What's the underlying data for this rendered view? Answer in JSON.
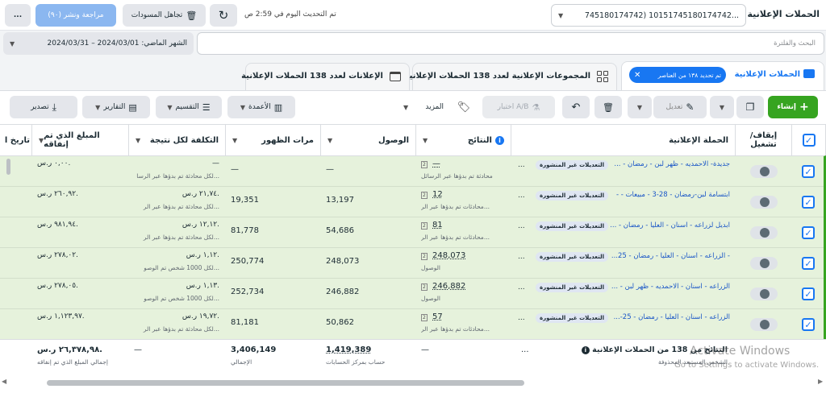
{
  "topbar": {
    "title": "الحملات الإعلانية",
    "account_selector": "745180174742)  10151745180174742...",
    "updated_text": "تم التحديث اليوم في 2:59 ص",
    "discard_label": "تجاهل المسودات",
    "review_label": "مراجعة ونشر (٩٠)",
    "more": "..."
  },
  "filters": {
    "search_placeholder": "البحث والفلترة",
    "date_range": "الشهر الماضي: 2024/03/01 – 2024/03/31"
  },
  "tabs": {
    "campaigns": "الحملات الإعلانية",
    "selected_chip": "تم تحديد ١٣٨ من العناصر",
    "adsets": "المجموعات الإعلانية لعدد 138 الحملات الإعلانية",
    "ads": "الإعلانات لعدد 138 الحملات الإعلانية"
  },
  "toolbar": {
    "create": "إنشاء",
    "edit": "تعديل",
    "ab_test": "اختبار A/B",
    "more": "المزيد",
    "columns": "الأعمدة",
    "breakdown": "التقسيم",
    "reports": "التقارير",
    "export": "تصدير"
  },
  "columns": {
    "toggle": "إيقاف/ تشغيل",
    "campaign": "الحملة الإعلانية",
    "results": "النتائج",
    "reach": "الوصول",
    "impressions": "مرات الظهور",
    "cost": "التكلفة لكل نتيجة",
    "spent": "المبلغ الذي تم إنفاقه",
    "end": "تاريخ ا"
  },
  "draft_badge": "التعديلات غير المنشورة",
  "rows": [
    {
      "campaign": "جديدة- الاحمديه - ظهر لبن - رمضان - ...",
      "results": "—",
      "results_sub": "محادثة تم بدؤها عبر الرسائل",
      "reach": "—",
      "impressions": "—",
      "cost": "—",
      "cost_sub": "لكل محادثة تم بدؤها عبر الرسا...",
      "spent": "٠,٠٠ ر.س."
    },
    {
      "campaign": "ابتسامة لبن-رمضان - 28-3 - مبيعات - -",
      "results": "12",
      "results_sub": "محادثات تم بدؤها عبر الر...",
      "reach": "13,197",
      "impressions": "19,351",
      "cost": "٢١,٧٤ ر.س.",
      "cost_sub": "لكل محادثة تم بدؤها عبر الر...",
      "spent": "٢٦٠,٩٢ ر.س."
    },
    {
      "campaign": "ابديل لزراعه - اسنان - العليا - رمضان - ...",
      "results": "81",
      "results_sub": "محادثات تم بدؤها عبر الر...",
      "reach": "54,686",
      "impressions": "81,778",
      "cost": "١٢,١٢ ر.س.",
      "cost_sub": "لكل محادثة تم بدؤها عبر الر...",
      "spent": "٩٨١,٩٤ ر.س."
    },
    {
      "campaign": "- الزراعه - اسنان - العليا - رمضان - 25...",
      "results": "248,073",
      "results_sub": "الوصول",
      "reach": "248,073",
      "impressions": "250,774",
      "cost": "١,١٢ ر.س.",
      "cost_sub": "لكل 1000 شخص تم الوصو...",
      "spent": "٢٧٨,٠٢ ر.س."
    },
    {
      "campaign": "الزراعه - اسنان - الاحمديه - ظهر لبن - ...",
      "results": "246,882",
      "results_sub": "الوصول",
      "reach": "246,882",
      "impressions": "252,734",
      "cost": "١,١٣ ر.س.",
      "cost_sub": "لكل 1000 شخص تم الوصو...",
      "spent": "٢٧٨,٠٥ ر.س."
    },
    {
      "campaign": "الزراعه - اسنان - العليا - رمضان - 25-...",
      "results": "57",
      "results_sub": "محادثات تم بدؤها عبر الر...",
      "reach": "50,862",
      "impressions": "81,181",
      "cost": "١٩,٧٢ ر.س.",
      "cost_sub": "لكل محادثة تم بدؤها عبر الر...",
      "spent": "١,١٢٣,٩٧ ر.س."
    }
  ],
  "summary": {
    "campaign": "النتائج من 138 من الحملات الإعلانية",
    "campaign_sub": "الشخص المستبعد المحذوفة",
    "results": "—",
    "reach": "1,419,389",
    "reach_sub": "حساب بمركز الحسابات",
    "impressions": "3,406,149",
    "impressions_sub": "الإجمالي",
    "cost": "—",
    "spent": "٢٦,٣٧٨,٩٨ ر.س.",
    "spent_sub": "إجمالي المبلغ الذي تم إنفاقه"
  },
  "watermark": {
    "line1": "Activate Windows",
    "line2": "Go to Settings to activate Windows."
  }
}
